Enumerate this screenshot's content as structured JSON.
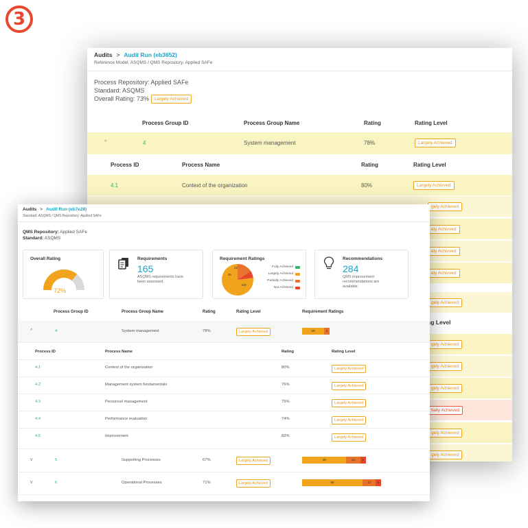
{
  "step_number": "3",
  "colors": {
    "accent": "#1ba3c6",
    "largely": "#f0a31b",
    "partially": "#e8742b",
    "not": "#e8472b",
    "fully": "#34b36b"
  },
  "back": {
    "breadcrumb": {
      "root": "Audits",
      "current": "Audit Run (eb3652)"
    },
    "subtitle": "Reference Model: ASQMS / QMS Repository: Applied SAFe",
    "info": {
      "repository": "Process Repository: Applied SAFe",
      "standard": "Standard: ASQMS",
      "overall": "Overall Rating: 73%",
      "overall_badge": "Largely Achieved"
    },
    "table_headers": {
      "id": "Process Group ID",
      "name": "Process Group Name",
      "rating": "Rating",
      "level": "Rating Level"
    },
    "group": {
      "id": "4",
      "name": "System management",
      "rating": "78%",
      "level": "Largely Achieved"
    },
    "process_headers": {
      "id": "Process ID",
      "name": "Process Name",
      "rating": "Rating",
      "level": "Rating Level"
    },
    "first_process": {
      "id": "4.1",
      "name": "Context of the organization",
      "rating": "80%",
      "level": "Largely Achieved"
    },
    "partial_badges": [
      "gely Achieved",
      "ely Achieved",
      "ely Achieved",
      "ely Achieved",
      "ely Achieved",
      "gely Achieved"
    ],
    "level_head_partial": "ng Level",
    "lower_badges": [
      "gely Achieved",
      "gely Achieved",
      "gely Achieved",
      "tially Achieved",
      "gely Achieved",
      "gely Achieved"
    ]
  },
  "front": {
    "breadcrumb": {
      "root": "Audits",
      "current": "Audit Run (eb7e28)"
    },
    "subtitle": "Standard: ASQMS / QMS Repository: Applied SAFe",
    "info": {
      "repo_label": "QMS Repository:",
      "repo_value": "Applied SAFe",
      "std_label": "Standard:",
      "std_value": "ASQMS"
    },
    "cards": {
      "overall": {
        "title": "Overall Rating",
        "value": "72%",
        "percent": 72
      },
      "requirements": {
        "title": "Requirements",
        "count": "165",
        "desc1": "ASQMS requirements have",
        "desc2": "been assessed."
      },
      "ratings": {
        "title": "Requirement Ratings",
        "legend": [
          "Fully Achieved",
          "Largely Achieved",
          "Partially Achieved",
          "Not Achieved"
        ],
        "slice_labels": {
          "largely": "123",
          "partially": "25",
          "not": "12"
        }
      },
      "recommendations": {
        "title": "Recommendations",
        "count": "284",
        "desc1": "QMS improvement",
        "desc2": "recommendations are",
        "desc3": "available."
      }
    },
    "table_headers": {
      "id": "Process Group ID",
      "name": "Process Group Name",
      "rating": "Rating",
      "level": "Rating Level",
      "req": "Requirement Ratings"
    },
    "group_main": {
      "id": "4",
      "name": "System management",
      "rating": "78%",
      "level": "Largely Achieved",
      "bar": {
        "largely": "20",
        "partially": "3"
      }
    },
    "process_headers": {
      "id": "Process ID",
      "name": "Process Name",
      "rating": "Rating",
      "level": "Rating Level"
    },
    "processes": [
      {
        "id": "4.1",
        "name": "Context of the organization",
        "rating": "80%",
        "level": "Largely Achieved"
      },
      {
        "id": "4.2",
        "name": "Management system fundamentals",
        "rating": "76%",
        "level": "Largely Achieved"
      },
      {
        "id": "4.3",
        "name": "Personnel management",
        "rating": "75%",
        "level": "Largely Achieved"
      },
      {
        "id": "4.4",
        "name": "Performance evaluation",
        "rating": "74%",
        "level": "Largely Achieved"
      },
      {
        "id": "4.5",
        "name": "Improvement",
        "rating": "83%",
        "level": "Largely Achieved"
      }
    ],
    "groups_other": [
      {
        "id": "5",
        "name": "Supporting Processes",
        "rating": "67%",
        "level": "Largely Achieved",
        "bar": {
          "largely": "40",
          "partially": "13",
          "not": "2"
        }
      },
      {
        "id": "6",
        "name": "Operational Processes",
        "rating": "71%",
        "level": "Largely Achieved",
        "bar": {
          "largely": "55",
          "partially": "12",
          "not": "5"
        }
      }
    ]
  }
}
